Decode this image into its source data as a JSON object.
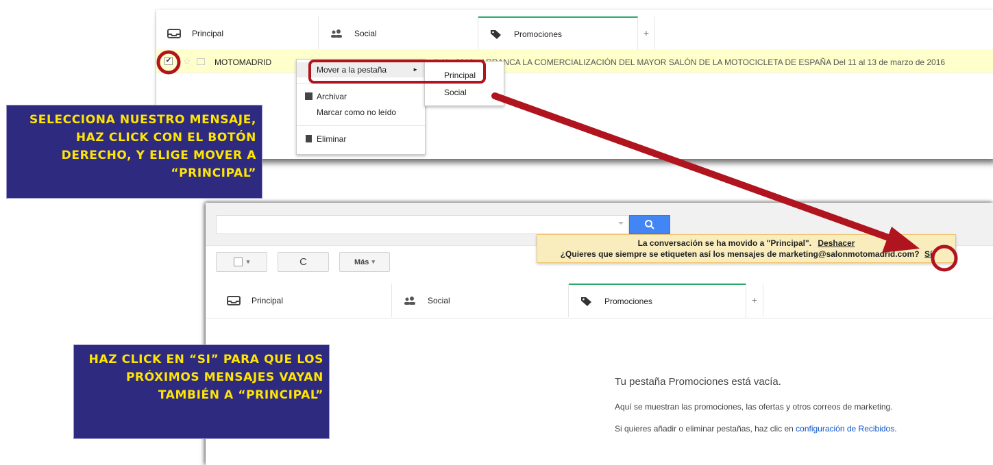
{
  "top_panel": {
    "tabs": [
      {
        "label": "Principal",
        "icon": "inbox-icon"
      },
      {
        "label": "Social",
        "icon": "people-icon"
      },
      {
        "label": "Promociones",
        "icon": "tag-icon"
      }
    ],
    "add_tab": "+",
    "message": {
      "sender": "MOTOMADRID",
      "subject_partial": "edición 2016 - ARRANCA LA COMERCIALIZACIÓN DEL MAYOR SALÓN DE LA MOTOCICLETA DE ESPAÑA Del 11 al 13 de marzo de 2016",
      "checked_mark": "✔"
    },
    "context_menu": {
      "move_to_tab": "Mover a la pestaña",
      "submenu_arrow": "►",
      "archive": "Archivar",
      "mark_unread": "Marcar como no leído",
      "delete": "Eliminar"
    },
    "submenu": [
      "Principal",
      "Social"
    ]
  },
  "bottom_panel": {
    "search": {
      "placeholder": "",
      "value": ""
    },
    "toolbar": {
      "more_label": "Más",
      "dropdown_caret": "▾",
      "refresh_glyph": "C"
    },
    "notice": {
      "line1": "La conversación se ha movido a \"Principal\".",
      "undo_link": "Deshacer",
      "line2": "¿Quieres que siempre se etiqueten así los mensajes de marketing@salonmotomadrid.com?",
      "yes_link": "Sí"
    },
    "tabs": [
      {
        "label": "Principal",
        "icon": "inbox-icon"
      },
      {
        "label": "Social",
        "icon": "people-icon"
      },
      {
        "label": "Promociones",
        "icon": "tag-icon"
      }
    ],
    "add_tab": "+",
    "empty_state": {
      "title": "Tu pestaña Promociones está vacía.",
      "line1": "Aquí se muestran las promociones, las ofertas y otros correos de marketing.",
      "line2_prefix": "Si quieres añadir o eliminar pestañas, haz clic en ",
      "line2_link": "configuración de Recibidos",
      "line2_suffix": "."
    }
  },
  "callouts": {
    "first": "Selecciona nuestro mensaje, haz click con el botón derecho, y elige mover a “Principal”",
    "second": "Haz click en “Si” para que los próximos mensajes vayan también a “Principal”"
  },
  "colors": {
    "callout_bg": "#2e2a80",
    "callout_text": "#ffe600",
    "annotation_red": "#b0141e",
    "active_tab_accent": "#2aa86a",
    "search_blue": "#4285f4",
    "notice_bg": "#f9edbe"
  }
}
